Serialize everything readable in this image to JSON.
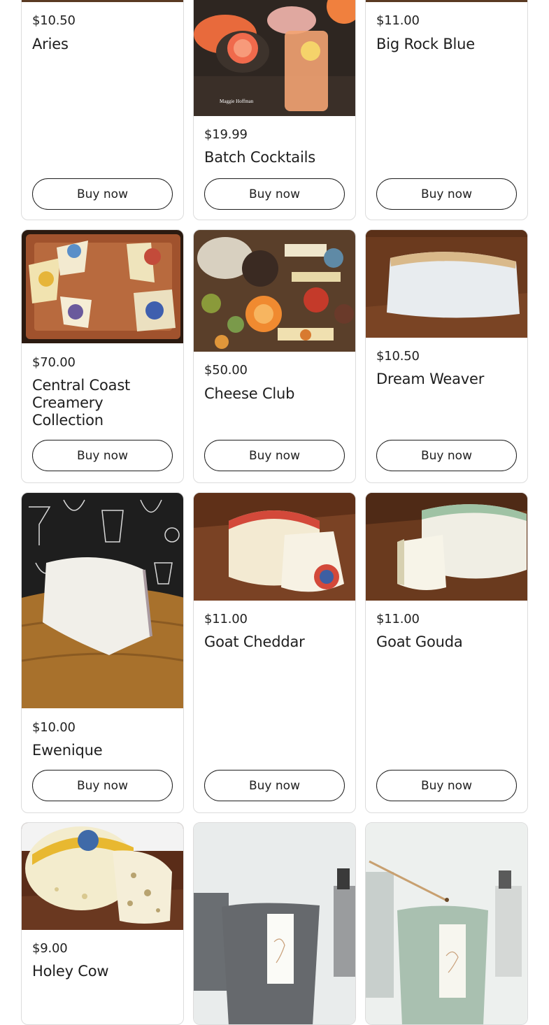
{
  "buy_label": "Buy now",
  "products": [
    {
      "price": "$10.50",
      "name": "Aries"
    },
    {
      "price": "$19.99",
      "name": "Batch Cocktails",
      "image_caption": "Maggie Hoffman"
    },
    {
      "price": "$11.00",
      "name": "Big Rock Blue"
    },
    {
      "price": "$70.00",
      "name": "Central Coast Creamery Collection"
    },
    {
      "price": "$50.00",
      "name": "Cheese Club"
    },
    {
      "price": "$10.50",
      "name": "Dream Weaver"
    },
    {
      "price": "$10.00",
      "name": "Ewenique"
    },
    {
      "price": "$11.00",
      "name": "Goat Cheddar"
    },
    {
      "price": "$11.00",
      "name": "Goat Gouda"
    },
    {
      "price": "$9.00",
      "name": "Holey Cow"
    },
    {
      "price": "",
      "name": ""
    },
    {
      "price": "",
      "name": ""
    }
  ]
}
